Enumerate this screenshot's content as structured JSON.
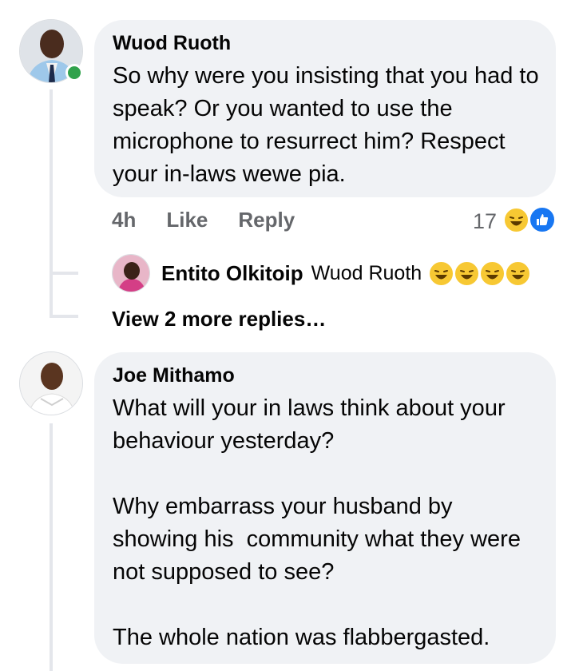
{
  "comment1": {
    "author": "Wuod Ruoth",
    "text": "So why were you insisting that you had to speak? Or you wanted to use the microphone to resurrect him? Respect your in-laws wewe pia.",
    "time": "4h",
    "like_label": "Like",
    "reply_label": "Reply",
    "reaction_count": "17",
    "reactions": [
      "laughing-emoji-icon",
      "like-reaction-icon"
    ],
    "online": true
  },
  "reply1": {
    "author": "Entito Olkitoip",
    "mention": "Wuod Ruoth",
    "emojis": [
      "laughing-emoji-icon",
      "laughing-emoji-icon",
      "laughing-emoji-icon",
      "laughing-emoji-icon"
    ]
  },
  "view_more_replies": "View 2 more replies…",
  "comment2": {
    "author": "Joe Mithamo",
    "text": "What will your in laws think about your behaviour yesterday?\n\nWhy embarrass your husband by showing his  community what they were not supposed to see?\n\nThe whole nation was flabbergasted."
  },
  "colors": {
    "bubble": "#f0f2f5",
    "meta_text": "#65676b",
    "online": "#31a24c",
    "like_blue": "#1877f2",
    "thread_line": "#e4e6eb"
  }
}
